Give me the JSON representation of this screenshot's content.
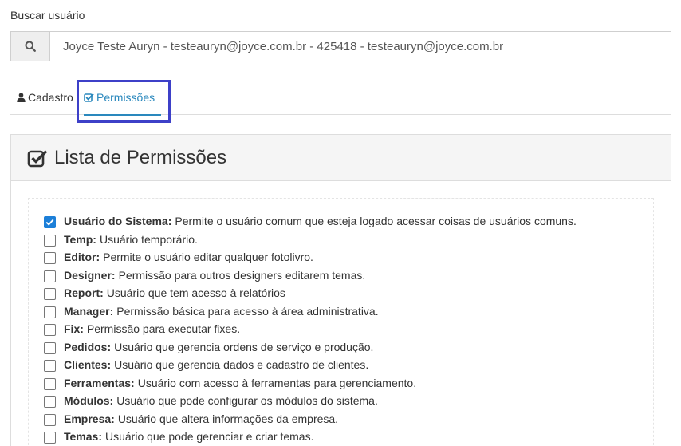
{
  "search": {
    "label": "Buscar usuário",
    "value": "Joyce Teste Auryn - testeauryn@joyce.com.br - 425418 - testeauryn@joyce.com.br"
  },
  "tabs": [
    {
      "label": "Cadastro",
      "icon": "user-icon",
      "active": false
    },
    {
      "label": "Permissões",
      "icon": "check-square-icon",
      "active": true
    }
  ],
  "panel": {
    "title": "Lista de Permissões",
    "icon": "check-square-icon"
  },
  "permissions": [
    {
      "name": "Usuário do Sistema:",
      "desc": "Permite o usuário comum que esteja logado acessar coisas de usuários comuns.",
      "checked": true
    },
    {
      "name": "Temp:",
      "desc": "Usuário temporário.",
      "checked": false
    },
    {
      "name": "Editor:",
      "desc": "Permite o usuário editar qualquer fotolivro.",
      "checked": false
    },
    {
      "name": "Designer:",
      "desc": "Permissão para outros designers editarem temas.",
      "checked": false
    },
    {
      "name": "Report:",
      "desc": "Usuário que tem acesso à relatórios",
      "checked": false
    },
    {
      "name": "Manager:",
      "desc": "Permissão básica para acesso à área administrativa.",
      "checked": false
    },
    {
      "name": "Fix:",
      "desc": "Permissão para executar fixes.",
      "checked": false
    },
    {
      "name": "Pedidos:",
      "desc": "Usuário que gerencia ordens de serviço e produção.",
      "checked": false
    },
    {
      "name": "Clientes:",
      "desc": "Usuário que gerencia dados e cadastro de clientes.",
      "checked": false
    },
    {
      "name": "Ferramentas:",
      "desc": "Usuário com acesso à ferramentas para gerenciamento.",
      "checked": false
    },
    {
      "name": "Módulos:",
      "desc": "Usuário que pode configurar os módulos do sistema.",
      "checked": false
    },
    {
      "name": "Empresa:",
      "desc": "Usuário que altera informações da empresa.",
      "checked": false
    },
    {
      "name": "Temas:",
      "desc": "Usuário que pode gerenciar e criar temas.",
      "checked": false
    }
  ],
  "colors": {
    "accent": "#2a88bd",
    "checkbox_checked": "#1c7fd8",
    "highlight_box": "#3d40c8"
  }
}
